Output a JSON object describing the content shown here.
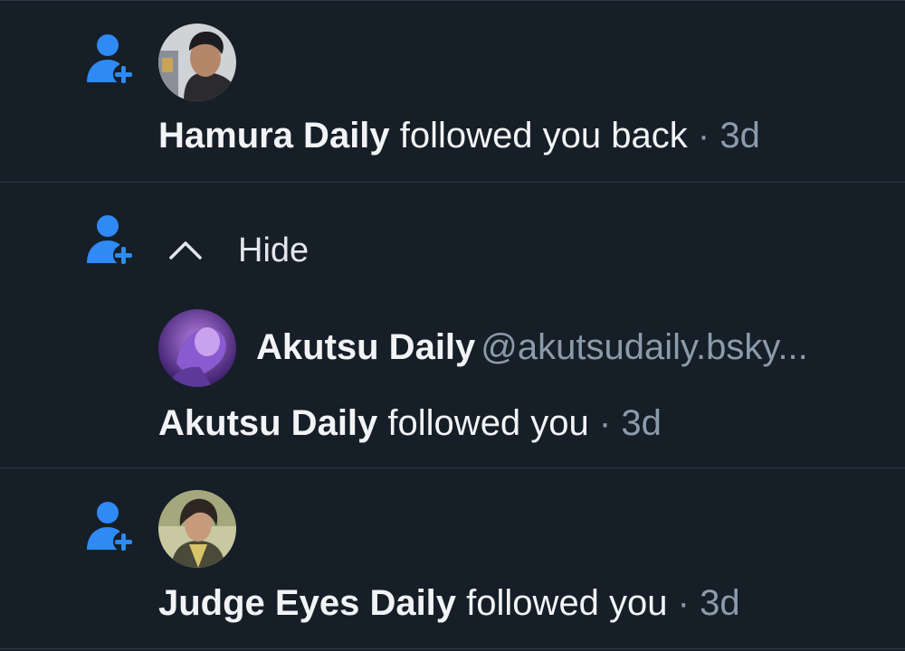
{
  "notifications": [
    {
      "name": "Hamura Daily",
      "action": "followed you back",
      "separator": "·",
      "time": "3d"
    },
    {
      "toggle_label": "Hide",
      "profile": {
        "name": "Akutsu Daily",
        "handle": "@akutsudaily.bsky..."
      },
      "name": "Akutsu Daily",
      "action": "followed you",
      "separator": "·",
      "time": "3d"
    },
    {
      "name": "Judge Eyes Daily",
      "action": "followed you",
      "separator": "·",
      "time": "3d"
    }
  ],
  "icons": {
    "follow": "person-plus-icon",
    "toggle": "chevron-up-icon"
  },
  "colors": {
    "background": "#161e27",
    "accent": "#2f8af5",
    "divider": "#2e3a47",
    "muted_text": "#8c9bab",
    "primary_text": "#f1f3f5"
  }
}
